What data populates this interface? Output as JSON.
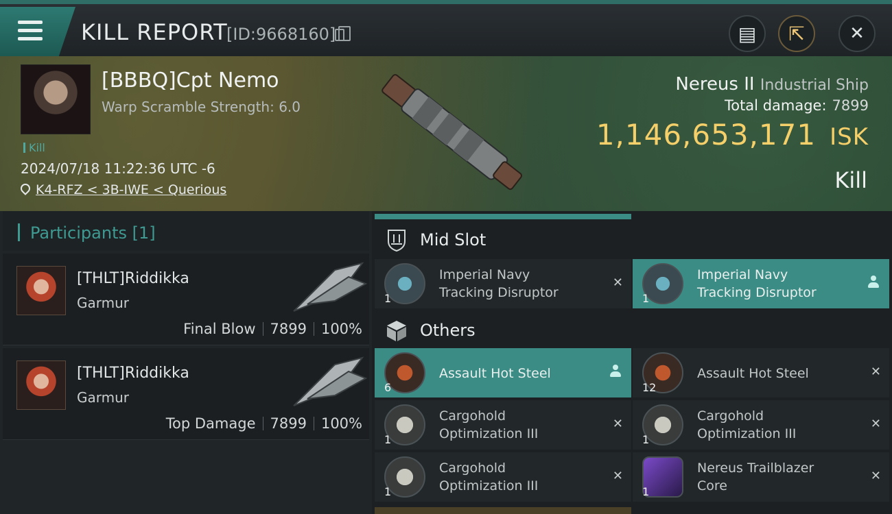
{
  "header": {
    "title": "KILL REPORT",
    "report_id": "[ID:9668160]",
    "icons": [
      "menu-icon",
      "copy-icon",
      "clipboard-icon",
      "share-icon",
      "close-icon"
    ],
    "clipboard_glyph": "▤",
    "share_glyph": "⇱",
    "close_glyph": "✕"
  },
  "victim": {
    "name": "[BBBQ]Cpt Nemo",
    "warp_scramble": "Warp Scramble Strength: 6.0",
    "kill_tag": "Kill",
    "datetime": "2024/07/18 11:22:36 UTC -6",
    "location": "K4-RFZ < 3B-IWE < Querious"
  },
  "ship": {
    "name": "Nereus II",
    "class": "Industrial Ship",
    "total_damage_label": "Total damage:",
    "total_damage": "7899",
    "isk_value": "1,146,653,171",
    "isk_unit": "ISK",
    "result": "Kill"
  },
  "participants": {
    "title": "Participants [1]",
    "entries": [
      {
        "name": "[THLT]Riddikka",
        "ship": "Garmur",
        "role": "Final Blow",
        "damage": "7899",
        "percent": "100%"
      },
      {
        "name": "[THLT]Riddikka",
        "ship": "Garmur",
        "role": "Top Damage",
        "damage": "7899",
        "percent": "100%"
      }
    ]
  },
  "slots": {
    "mid_title": "Mid Slot",
    "others_title": "Others",
    "mid_items": [
      {
        "qty": "1",
        "name_line1": "Imperial Navy",
        "name_line2": "Tracking Disruptor",
        "status": "destroyed",
        "mark": "✕"
      },
      {
        "qty": "1",
        "name_line1": "Imperial Navy",
        "name_line2": "Tracking Disruptor",
        "status": "dropped"
      }
    ],
    "other_items": [
      {
        "qty": "6",
        "name_line1": "Assault Hot Steel",
        "name_line2": "",
        "status": "dropped"
      },
      {
        "qty": "12",
        "name_line1": "Assault Hot Steel",
        "name_line2": "",
        "status": "destroyed",
        "mark": "✕"
      },
      {
        "qty": "1",
        "name_line1": "Cargohold",
        "name_line2": "Optimization III",
        "status": "destroyed",
        "mark": "✕"
      },
      {
        "qty": "1",
        "name_line1": "Cargohold",
        "name_line2": "Optimization III",
        "status": "destroyed",
        "mark": "✕"
      },
      {
        "qty": "1",
        "name_line1": "Cargohold",
        "name_line2": "Optimization III",
        "status": "destroyed",
        "mark": "✕"
      },
      {
        "qty": "1",
        "name_line1": "Nereus Trailblazer",
        "name_line2": "Core",
        "status": "destroyed",
        "mark": "✕"
      }
    ]
  },
  "colors": {
    "accent": "#3b8c84",
    "isk": "#f5cf6a",
    "background": "#1c2023"
  }
}
